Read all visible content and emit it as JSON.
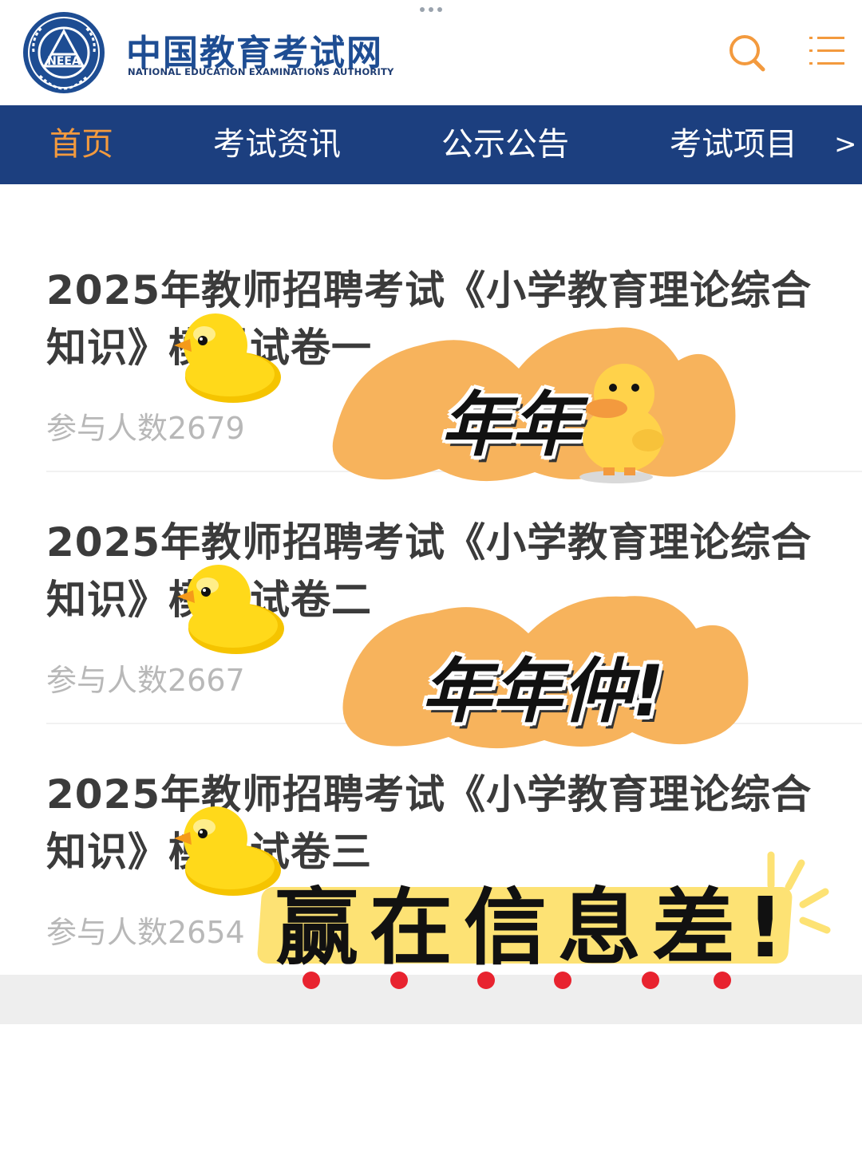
{
  "header": {
    "brand_cn": "中国教育考试网",
    "brand_en": "NATIONAL EDUCATION EXAMINATIONS AUTHORITY",
    "logo_text": "NEEA",
    "icons": [
      "search-icon",
      "menu-icon"
    ]
  },
  "nav": {
    "items": [
      "首页",
      "考试资讯",
      "公示公告",
      "考试项目"
    ],
    "active_index": 0,
    "next_label": ">"
  },
  "articles": [
    {
      "title": "2025年教师招聘考试《小学教育理论综合知识》模拟试卷一",
      "meta": "参与人数2679"
    },
    {
      "title": "2025年教师招聘考试《小学教育理论综合知识》模拟试卷二",
      "meta": "参与人数2667"
    },
    {
      "title": "2025年教师招聘考试《小学教育理论综合知识》模拟试卷三",
      "meta": "参与人数2654"
    }
  ],
  "stickers": {
    "sticker1_text": "年年",
    "sticker2_text": "年年仲!",
    "banner_text": "赢在信息差!"
  },
  "colors": {
    "brand_blue": "#1e4d93",
    "nav_bg": "#1c3f7f",
    "nav_active": "#f39a3e",
    "sticker_orange": "#f7b35c",
    "banner_yellow": "#fde274",
    "dot_red": "#e8232f"
  }
}
